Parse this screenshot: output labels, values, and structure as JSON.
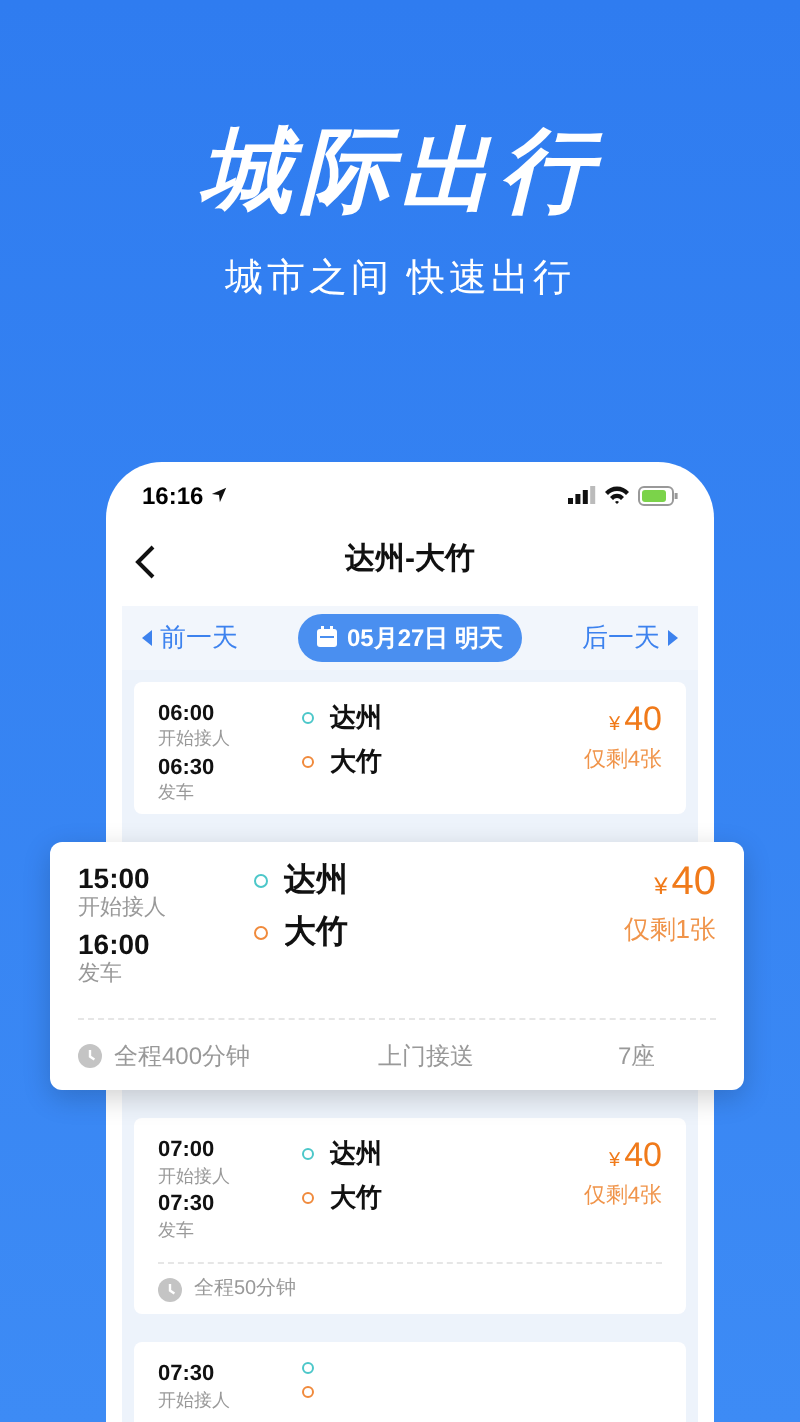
{
  "hero": {
    "title": "城际出行",
    "subtitle": "城市之间 快速出行"
  },
  "status_bar": {
    "time": "16:16"
  },
  "nav": {
    "title": "达州-大竹"
  },
  "date_bar": {
    "prev": "前一天",
    "date": "05月27日 明天",
    "next": "后一天"
  },
  "trips": [
    {
      "elevated": false,
      "pickup_time": "06:00",
      "pickup_label": "开始接人",
      "depart_time": "06:30",
      "depart_label": "发车",
      "from": "达州",
      "to": "大竹",
      "currency": "¥",
      "price": "40",
      "remaining": "仅剩4张"
    },
    {
      "elevated": true,
      "pickup_time": "15:00",
      "pickup_label": "开始接人",
      "depart_time": "16:00",
      "depart_label": "发车",
      "from": "达州",
      "to": "大竹",
      "currency": "¥",
      "price": "40",
      "remaining": "仅剩1张",
      "footer": {
        "duration": "全程400分钟",
        "service": "上门接送",
        "seats": "7座"
      }
    },
    {
      "elevated": false,
      "pickup_time": "07:00",
      "pickup_label": "开始接人",
      "depart_time": "07:30",
      "depart_label": "发车",
      "from": "达州",
      "to": "大竹",
      "currency": "¥",
      "price": "40",
      "remaining": "仅剩4张",
      "footer": {
        "duration": "全程50分钟"
      }
    },
    {
      "elevated": false,
      "pickup_time": "07:30",
      "pickup_label": "开始接人"
    }
  ]
}
